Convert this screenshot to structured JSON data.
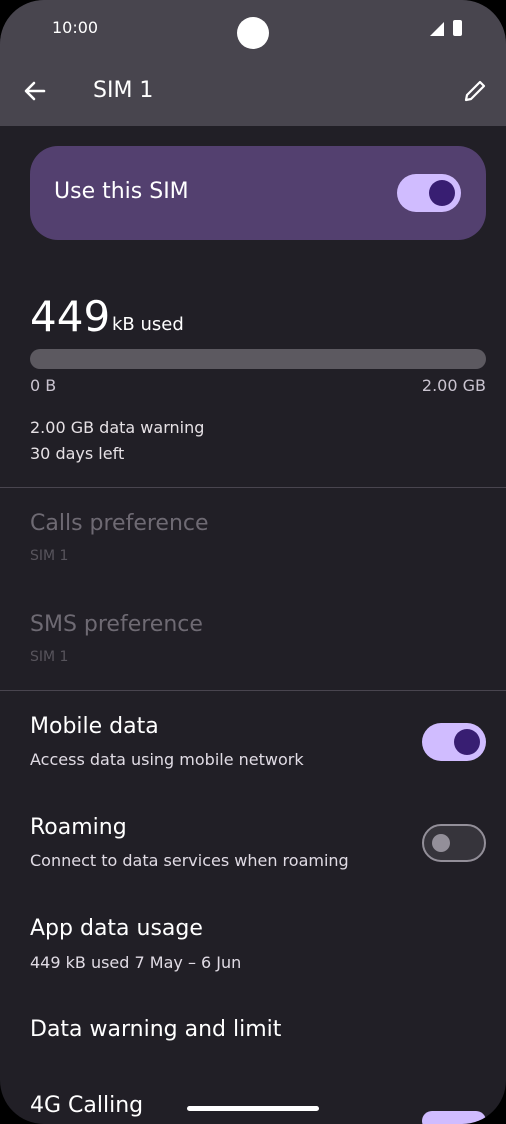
{
  "status": {
    "time": "10:00"
  },
  "appbar": {
    "title": "SIM 1"
  },
  "sim": {
    "label": "Use this SIM",
    "enabled": true
  },
  "usage": {
    "amount": "449",
    "unit": "kB used",
    "fraction": 0.0,
    "min_label": "0 B",
    "max_label": "2.00 GB",
    "warning": "2.00 GB data warning",
    "days_left": "30 days left"
  },
  "calls": {
    "title": "Calls preference",
    "subtitle": "SIM 1"
  },
  "sms": {
    "title": "SMS preference",
    "subtitle": "SIM 1"
  },
  "mobile_data": {
    "title": "Mobile data",
    "subtitle": "Access data using mobile network",
    "enabled": true
  },
  "roaming": {
    "title": "Roaming",
    "subtitle": "Connect to data services when roaming",
    "enabled": false
  },
  "app_usage": {
    "title": "App data usage",
    "subtitle": "449 kB used 7 May – 6 Jun"
  },
  "data_warning": {
    "title": "Data warning and limit"
  },
  "calling": {
    "title": "4G Calling",
    "enabled": true
  },
  "icons": {
    "back": "arrow-back-icon",
    "edit": "pencil-edit-icon",
    "signal": "signal-icon",
    "battery": "battery-icon"
  },
  "colors": {
    "accent": "#d0bcff",
    "card": "#53406f",
    "background": "#211f26",
    "header": "#48454e"
  }
}
